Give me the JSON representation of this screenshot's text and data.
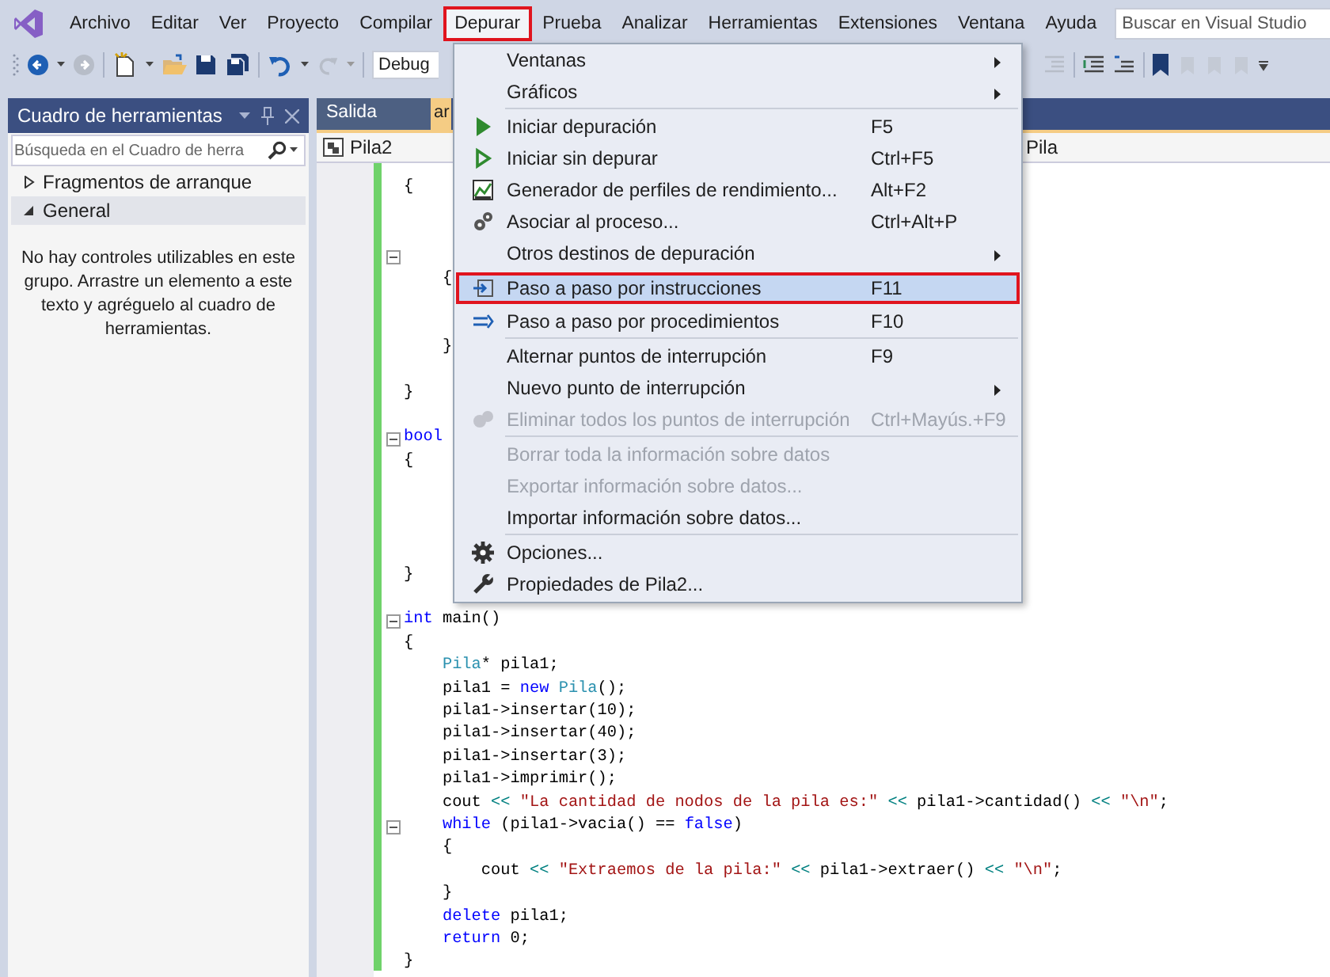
{
  "menubar": {
    "items": [
      {
        "label": "Archivo",
        "selected": false
      },
      {
        "label": "Editar",
        "selected": false
      },
      {
        "label": "Ver",
        "selected": false
      },
      {
        "label": "Proyecto",
        "selected": false
      },
      {
        "label": "Compilar",
        "selected": false
      },
      {
        "label": "Depurar",
        "selected": true
      },
      {
        "label": "Prueba",
        "selected": false
      },
      {
        "label": "Analizar",
        "selected": false
      },
      {
        "label": "Herramientas",
        "selected": false
      },
      {
        "label": "Extensiones",
        "selected": false
      },
      {
        "label": "Ventana",
        "selected": false
      },
      {
        "label": "Ayuda",
        "selected": false
      }
    ],
    "search": {
      "placeholder": "Buscar en Visual Studio"
    }
  },
  "toolbar": {
    "configuration": "Debug"
  },
  "toolbox": {
    "title": "Cuadro de herramientas",
    "search": {
      "placeholder": "Búsqueda en el Cuadro de herra"
    },
    "groups": [
      {
        "label": "Fragmentos de arranque",
        "expanded": false,
        "selected": false
      },
      {
        "label": "General",
        "expanded": true,
        "selected": true
      }
    ],
    "message": "No hay controles utilizables en este grupo. Arrastre un elemento a este texto y agréguelo al cuadro de herramientas."
  },
  "editor": {
    "tabs": [
      {
        "label": "Salida",
        "selected": false
      },
      {
        "label": "ar",
        "selected": true
      }
    ],
    "nav": {
      "project": "Pila2",
      "scope": "Pila"
    },
    "lines": [
      {
        "fold": false,
        "tokens": [
          {
            "text": "{",
            "kind": "plain"
          }
        ]
      },
      {
        "fold": false
      },
      {
        "fold": false
      },
      {
        "fold": true
      },
      {
        "fold": false,
        "tokens": [
          {
            "text": "    {",
            "kind": "plain"
          }
        ]
      },
      {
        "fold": false
      },
      {
        "fold": false
      },
      {
        "fold": false,
        "tokens": [
          {
            "text": "    }",
            "kind": "plain"
          }
        ]
      },
      {
        "fold": false
      },
      {
        "fold": false,
        "tokens": [
          {
            "text": "}",
            "kind": "plain"
          }
        ]
      },
      {
        "fold": false
      },
      {
        "fold": true,
        "tokens": [
          {
            "text": "bool",
            "kind": "kw"
          }
        ]
      },
      {
        "fold": false,
        "tokens": [
          {
            "text": "{",
            "kind": "plain"
          }
        ]
      },
      {
        "fold": false
      },
      {
        "fold": false
      },
      {
        "fold": false
      },
      {
        "fold": false
      },
      {
        "fold": false,
        "tokens": [
          {
            "text": "}",
            "kind": "plain"
          }
        ]
      },
      {
        "fold": false
      },
      {
        "fold": true,
        "tokens": [
          {
            "text": "int",
            "kind": "kw"
          },
          {
            "text": " main()",
            "kind": "plain"
          }
        ]
      },
      {
        "fold": false,
        "tokens": [
          {
            "text": "{",
            "kind": "plain"
          }
        ]
      },
      {
        "fold": false,
        "tokens": [
          {
            "text": "    Pila",
            "kind": "type"
          },
          {
            "text": "* pila1;",
            "kind": "plain"
          }
        ]
      },
      {
        "fold": false,
        "tokens": [
          {
            "text": "    pila1 = ",
            "kind": "plain"
          },
          {
            "text": "new",
            "kind": "kw"
          },
          {
            "text": " Pila",
            "kind": "type"
          },
          {
            "text": "();",
            "kind": "plain"
          }
        ]
      },
      {
        "fold": false,
        "tokens": [
          {
            "text": "    pila1->insertar(10);",
            "kind": "plain"
          }
        ]
      },
      {
        "fold": false,
        "tokens": [
          {
            "text": "    pila1->insertar(40);",
            "kind": "plain"
          }
        ]
      },
      {
        "fold": false,
        "tokens": [
          {
            "text": "    pila1->insertar(3);",
            "kind": "plain"
          }
        ]
      },
      {
        "fold": false,
        "tokens": [
          {
            "text": "    pila1->imprimir();",
            "kind": "plain"
          }
        ]
      },
      {
        "fold": false,
        "tokens": [
          {
            "text": "    cout ",
            "kind": "plain"
          },
          {
            "text": "<< ",
            "kind": "op"
          },
          {
            "text": "\"La cantidad de nodos de la pila es:\" ",
            "kind": "str"
          },
          {
            "text": "<<",
            "kind": "op"
          },
          {
            "text": " pila1->cantidad() ",
            "kind": "plain"
          },
          {
            "text": "<< ",
            "kind": "op"
          },
          {
            "text": "\"\\n\"",
            "kind": "str"
          },
          {
            "text": ";",
            "kind": "plain"
          }
        ]
      },
      {
        "fold": true,
        "tokens": [
          {
            "text": "    while",
            "kind": "kw"
          },
          {
            "text": " (pila1->vacia() == ",
            "kind": "plain"
          },
          {
            "text": "false",
            "kind": "kw"
          },
          {
            "text": ")",
            "kind": "plain"
          }
        ]
      },
      {
        "fold": false,
        "tokens": [
          {
            "text": "    {",
            "kind": "plain"
          }
        ]
      },
      {
        "fold": false,
        "tokens": [
          {
            "text": "        cout ",
            "kind": "plain"
          },
          {
            "text": "<< ",
            "kind": "op"
          },
          {
            "text": "\"Extraemos de la pila:\" ",
            "kind": "str"
          },
          {
            "text": "<<",
            "kind": "op"
          },
          {
            "text": " pila1->extraer() ",
            "kind": "plain"
          },
          {
            "text": "<< ",
            "kind": "op"
          },
          {
            "text": "\"\\n\"",
            "kind": "str"
          },
          {
            "text": ";",
            "kind": "plain"
          }
        ]
      },
      {
        "fold": false,
        "tokens": [
          {
            "text": "    }",
            "kind": "plain"
          }
        ]
      },
      {
        "fold": false,
        "tokens": [
          {
            "text": "    delete",
            "kind": "kw"
          },
          {
            "text": " pila1;",
            "kind": "plain"
          }
        ]
      },
      {
        "fold": false,
        "tokens": [
          {
            "text": "    return",
            "kind": "kw"
          },
          {
            "text": " 0;",
            "kind": "plain"
          }
        ]
      },
      {
        "fold": false,
        "tokens": [
          {
            "text": "}",
            "kind": "plain"
          }
        ]
      }
    ]
  },
  "debug_menu": {
    "items": [
      {
        "kind": "item",
        "label": "Ventanas",
        "submenu": true,
        "disabled": false,
        "selected": false
      },
      {
        "kind": "item",
        "label": "Gráficos",
        "submenu": true,
        "disabled": false,
        "selected": false
      },
      {
        "kind": "separator"
      },
      {
        "kind": "item",
        "label": "Iniciar depuración",
        "shortcut": "F5",
        "submenu": false,
        "disabled": false,
        "selected": false
      },
      {
        "kind": "item",
        "label": "Iniciar sin depurar",
        "shortcut": "Ctrl+F5",
        "submenu": false,
        "disabled": false,
        "selected": false
      },
      {
        "kind": "item",
        "label": "Generador de perfiles de rendimiento...",
        "shortcut": "Alt+F2",
        "submenu": false,
        "disabled": false,
        "selected": false
      },
      {
        "kind": "item",
        "label": "Asociar al proceso...",
        "shortcut": "Ctrl+Alt+P",
        "submenu": false,
        "disabled": false,
        "selected": false
      },
      {
        "kind": "item",
        "label": "Otros destinos de depuración",
        "submenu": true,
        "disabled": false,
        "selected": false
      },
      {
        "kind": "item",
        "label": "Paso a paso por instrucciones",
        "shortcut": "F11",
        "submenu": false,
        "disabled": false,
        "selected": true
      },
      {
        "kind": "item",
        "label": "Paso a paso por procedimientos",
        "shortcut": "F10",
        "submenu": false,
        "disabled": false,
        "selected": false
      },
      {
        "kind": "separator"
      },
      {
        "kind": "item",
        "label": "Alternar puntos de interrupción",
        "shortcut": "F9",
        "submenu": false,
        "disabled": false,
        "selected": false
      },
      {
        "kind": "item",
        "label": "Nuevo punto de interrupción",
        "submenu": true,
        "disabled": false,
        "selected": false
      },
      {
        "kind": "item",
        "label": "Eliminar todos los puntos de interrupción",
        "shortcut": "Ctrl+Mayús.+F9",
        "submenu": false,
        "disabled": true,
        "selected": false
      },
      {
        "kind": "separator"
      },
      {
        "kind": "item",
        "label": "Borrar toda la información sobre datos",
        "submenu": false,
        "disabled": true,
        "selected": false
      },
      {
        "kind": "item",
        "label": "Exportar información sobre datos...",
        "submenu": false,
        "disabled": true,
        "selected": false
      },
      {
        "kind": "item",
        "label": "Importar información sobre datos...",
        "submenu": false,
        "disabled": false,
        "selected": false
      },
      {
        "kind": "separator"
      },
      {
        "kind": "item",
        "label": "Opciones...",
        "submenu": false,
        "disabled": false,
        "selected": false
      },
      {
        "kind": "item",
        "label": "Propiedades de Pila2...",
        "submenu": false,
        "disabled": false,
        "selected": false
      }
    ]
  }
}
